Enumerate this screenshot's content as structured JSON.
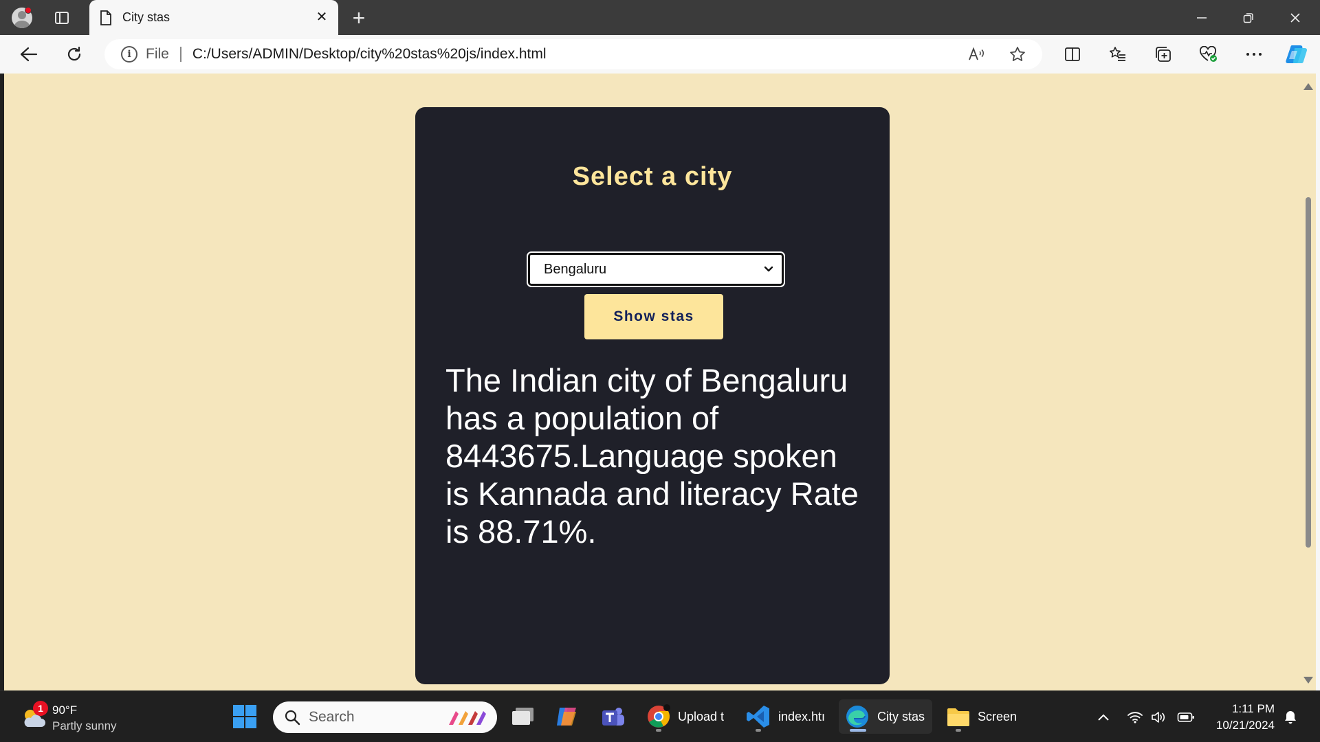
{
  "browser": {
    "tab_title": "City stas",
    "address_scheme": "File",
    "address_url": "C:/Users/ADMIN/Desktop/city%20stas%20js/index.html"
  },
  "page": {
    "heading": "Select a city",
    "city_select": {
      "selected": "Bengaluru"
    },
    "show_button_label": "Show stas",
    "result_text": "The Indian city of Bengaluru has a population of 8443675.Language spoken is Kannada and literacy Rate is 88.71%.",
    "colors": {
      "page_bg": "#f5e6bd",
      "card_bg": "#1f2029",
      "accent": "#fde59b",
      "button_text": "#12205a"
    }
  },
  "taskbar": {
    "weather": {
      "temp": "90°F",
      "desc": "Partly sunny",
      "badge": "1"
    },
    "search_label": "Search",
    "apps": [
      {
        "label": "Upload t"
      },
      {
        "label": "index.htı"
      },
      {
        "label": "City stas"
      },
      {
        "label": "Screen"
      }
    ],
    "time": "1:11 PM",
    "date": "10/21/2024"
  }
}
